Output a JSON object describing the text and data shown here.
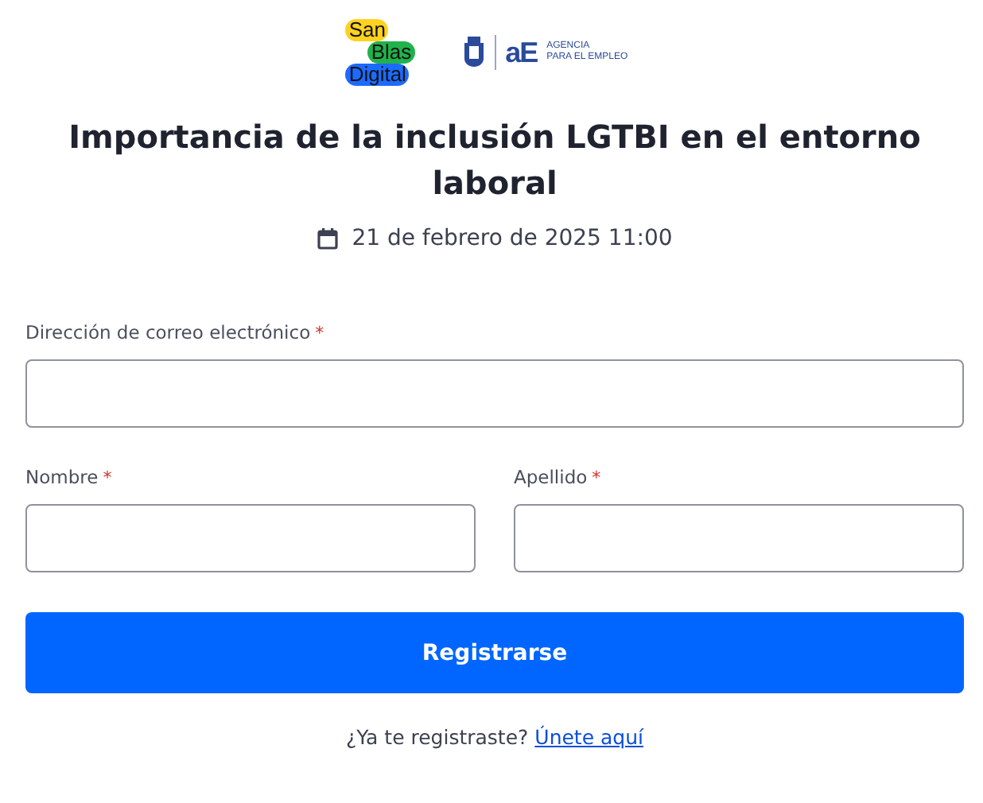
{
  "logos": {
    "san_blas": [
      "San",
      "Blas",
      "Digital"
    ],
    "agency_mark": "aE",
    "agency_name": [
      "AGENCIA",
      "PARA EL EMPLEO"
    ]
  },
  "title": "Importancia de la inclusión LGTBI en el entorno laboral",
  "date": "21 de febrero de 2025 11:00",
  "fields": [
    {
      "label": "Dirección de correo electrónico",
      "required": true,
      "wide": true
    },
    {
      "label": "Nombre",
      "required": true,
      "wide": false
    },
    {
      "label": "Apellido",
      "required": true,
      "wide": false
    }
  ],
  "required_mark": "*",
  "submit": "Registrarse",
  "footer": {
    "text": "¿Ya te registraste?",
    "link": "Únete aquí"
  }
}
